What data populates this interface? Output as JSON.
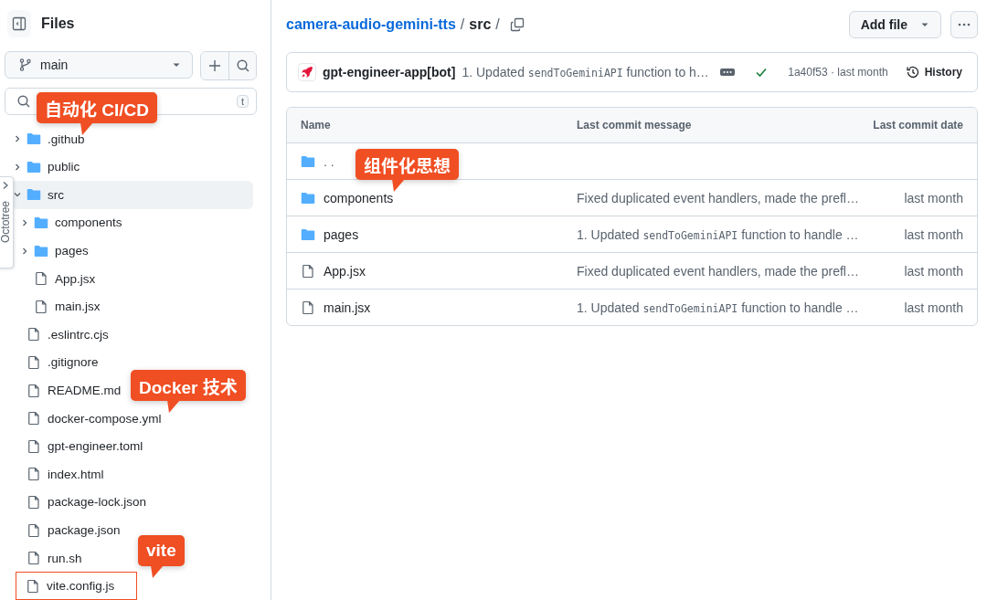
{
  "sidebar": {
    "title": "Files",
    "branch": "main",
    "search_key_hint": "t",
    "tree": [
      {
        "name": ".github",
        "kind": "folder",
        "expanded": false,
        "selected": false,
        "highlighted": false
      },
      {
        "name": "public",
        "kind": "folder",
        "expanded": false,
        "selected": false,
        "highlighted": false
      },
      {
        "name": "src",
        "kind": "folder",
        "expanded": true,
        "selected": true,
        "highlighted": false,
        "children": [
          {
            "name": "components",
            "kind": "folder",
            "expanded": false,
            "selected": false,
            "highlighted": false
          },
          {
            "name": "pages",
            "kind": "folder",
            "expanded": false,
            "selected": false,
            "highlighted": false
          },
          {
            "name": "App.jsx",
            "kind": "file",
            "selected": false,
            "highlighted": false
          },
          {
            "name": "main.jsx",
            "kind": "file",
            "selected": false,
            "highlighted": false
          }
        ]
      },
      {
        "name": ".eslintrc.cjs",
        "kind": "file",
        "selected": false,
        "highlighted": false
      },
      {
        "name": ".gitignore",
        "kind": "file",
        "selected": false,
        "highlighted": false
      },
      {
        "name": "README.md",
        "kind": "file",
        "selected": false,
        "highlighted": false
      },
      {
        "name": "docker-compose.yml",
        "kind": "file",
        "selected": false,
        "highlighted": false
      },
      {
        "name": "gpt-engineer.toml",
        "kind": "file",
        "selected": false,
        "highlighted": false
      },
      {
        "name": "index.html",
        "kind": "file",
        "selected": false,
        "highlighted": false
      },
      {
        "name": "package-lock.json",
        "kind": "file",
        "selected": false,
        "highlighted": false
      },
      {
        "name": "package.json",
        "kind": "file",
        "selected": false,
        "highlighted": false
      },
      {
        "name": "run.sh",
        "kind": "file",
        "selected": false,
        "highlighted": false
      },
      {
        "name": "vite.config.js",
        "kind": "file",
        "selected": false,
        "highlighted": true
      }
    ]
  },
  "octotree_tab": {
    "label": "Octotree"
  },
  "breadcrumb": {
    "repo": "camera-audio-gemini-tts",
    "separator_1": "/",
    "folder": "src",
    "separator_2": "/"
  },
  "actions": {
    "add_file": "Add file"
  },
  "commit": {
    "author": "gpt-engineer-app[bot]",
    "message": [
      {
        "kind": "plain",
        "text": "1. Updated "
      },
      {
        "kind": "code",
        "text": "sendToGeminiAPI"
      },
      {
        "kind": "plain",
        "text": " function to h…"
      }
    ],
    "sha_time": "1a40f53 · last month",
    "history": "History"
  },
  "table": {
    "columns": [
      "Name",
      "Last commit message",
      "Last commit date"
    ],
    "rows": [
      {
        "kind": "parent",
        "name": ". ."
      },
      {
        "kind": "folder",
        "name": "components",
        "message": [
          {
            "kind": "plain",
            "text": "Fixed duplicated event handlers, made the prefl…"
          }
        ],
        "date": "last month"
      },
      {
        "kind": "folder",
        "name": "pages",
        "message": [
          {
            "kind": "plain",
            "text": "1. Updated "
          },
          {
            "kind": "code",
            "text": "sendToGeminiAPI"
          },
          {
            "kind": "plain",
            "text": " function to handle …"
          }
        ],
        "date": "last month"
      },
      {
        "kind": "file",
        "name": "App.jsx",
        "message": [
          {
            "kind": "plain",
            "text": "Fixed duplicated event handlers, made the prefl…"
          }
        ],
        "date": "last month"
      },
      {
        "kind": "file",
        "name": "main.jsx",
        "message": [
          {
            "kind": "plain",
            "text": "1. Updated "
          },
          {
            "kind": "code",
            "text": "sendToGeminiAPI"
          },
          {
            "kind": "plain",
            "text": " function to handle …"
          }
        ],
        "date": "last month"
      }
    ]
  },
  "annotations": [
    {
      "text": "自动化 CI/CD"
    },
    {
      "text": "组件化思想"
    },
    {
      "text": "Docker 技术"
    },
    {
      "text": "vite"
    }
  ]
}
